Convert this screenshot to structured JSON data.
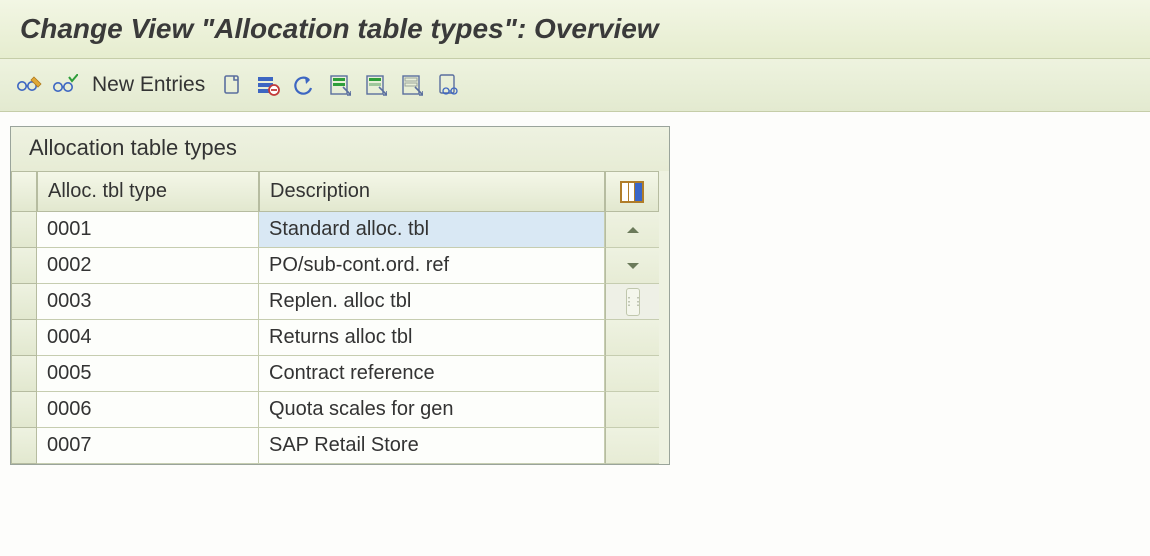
{
  "title": "Change View \"Allocation table types\": Overview",
  "toolbar": {
    "new_entries": "New Entries"
  },
  "panel": {
    "title": "Allocation table types",
    "columns": {
      "type": "Alloc. tbl type",
      "desc": "Description"
    },
    "rows": [
      {
        "type": "0001",
        "desc": "Standard alloc. tbl",
        "selected": true
      },
      {
        "type": "0002",
        "desc": "PO/sub-cont.ord. ref"
      },
      {
        "type": "0003",
        "desc": "Replen. alloc tbl"
      },
      {
        "type": "0004",
        "desc": "Returns alloc tbl"
      },
      {
        "type": "0005",
        "desc": "Contract reference"
      },
      {
        "type": "0006",
        "desc": "Quota scales for gen"
      },
      {
        "type": "0007",
        "desc": "SAP Retail Store"
      }
    ]
  }
}
